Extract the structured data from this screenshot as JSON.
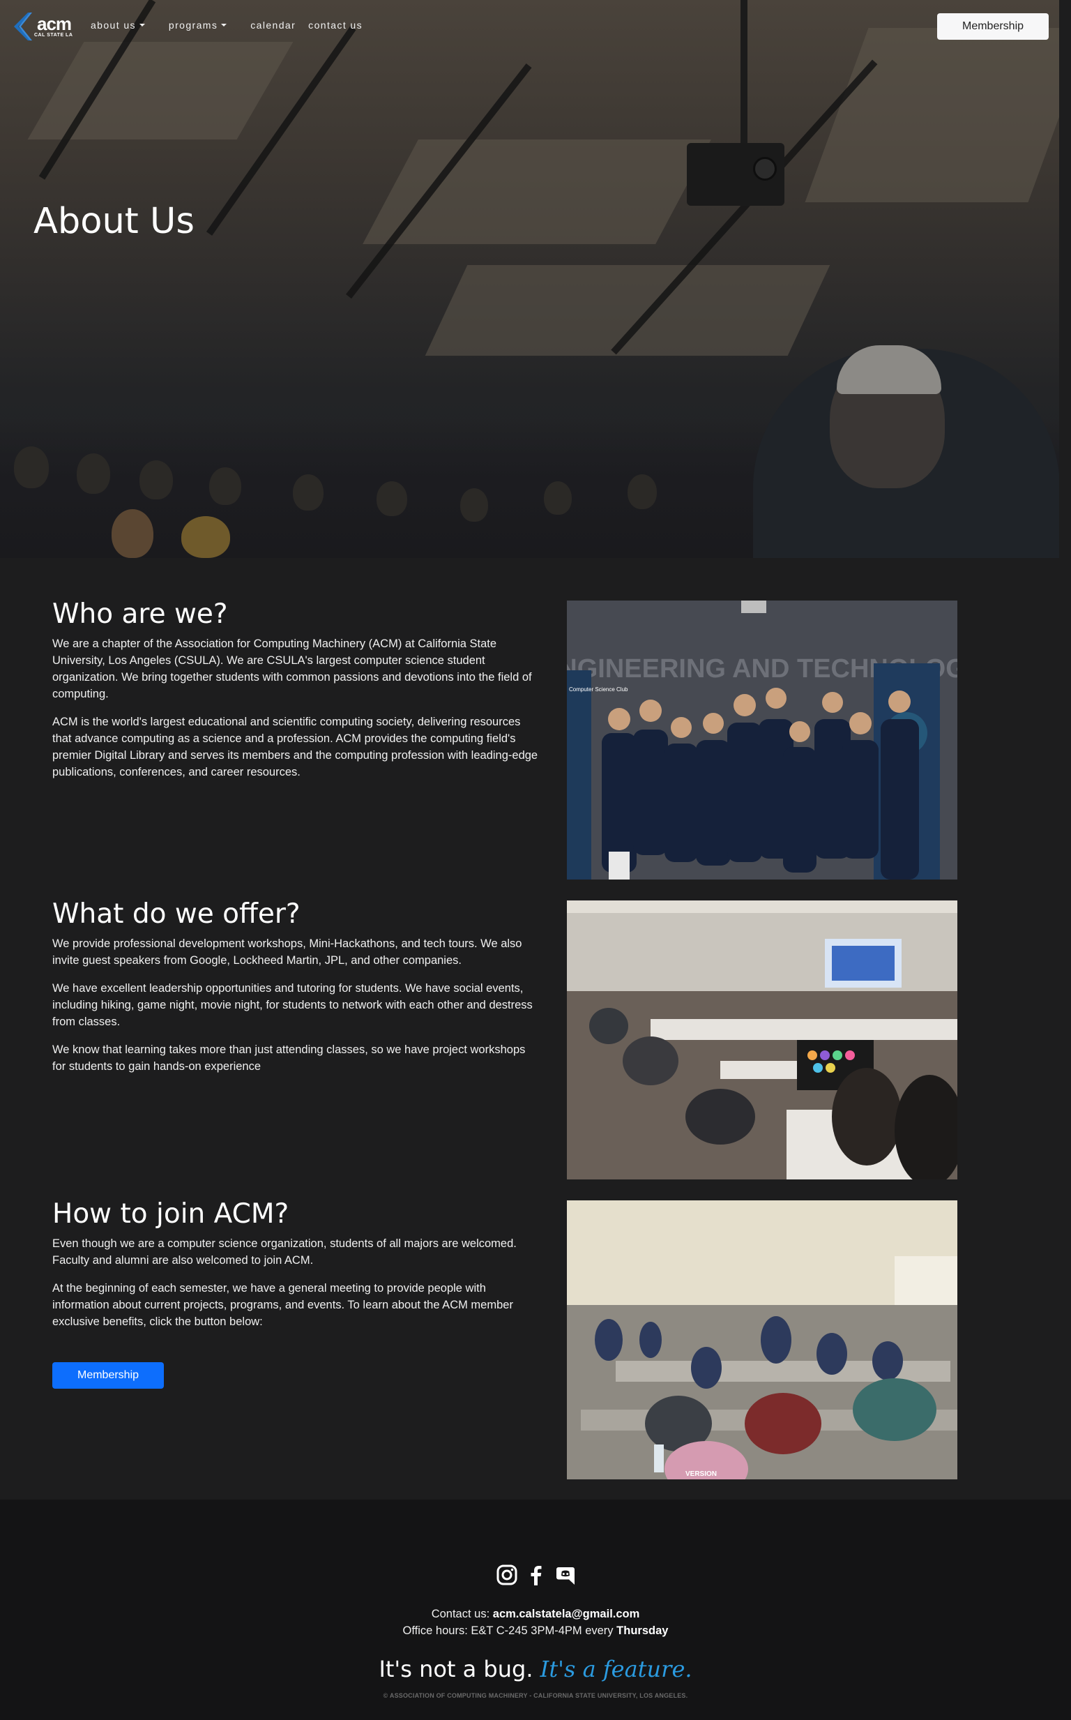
{
  "nav": {
    "logo_text": "acm",
    "logo_sub": "CAL STATE LA",
    "links": [
      {
        "label": "about us",
        "dropdown": true
      },
      {
        "label": "programs",
        "dropdown": true
      },
      {
        "label": "calendar",
        "dropdown": false
      },
      {
        "label": "contact us",
        "dropdown": false
      }
    ],
    "membership_label": "Membership"
  },
  "hero": {
    "title": "About Us"
  },
  "sections": [
    {
      "heading": "Who are we?",
      "paragraphs": [
        "We are a chapter of the Association for Computing Machinery (ACM) at California State University, Los Angeles (CSULA). We are CSULA's largest computer science student organization. We bring together students with common passions and devotions into the field of computing.",
        "ACM is the world's largest educational and scientific computing society, delivering resources that advance computing as a science and a profession. ACM provides the computing field's premier Digital Library and serves its members and the computing profession with leading-edge publications, conferences, and career resources."
      ],
      "photo_text": "ENGINEERING AND TECHNOLOGY",
      "banner_text": "Computer Science Club"
    },
    {
      "heading": "What do we offer?",
      "paragraphs": [
        "We provide professional development workshops, Mini-Hackathons, and tech tours. We also invite guest speakers from Google, Lockheed Martin, JPL, and other companies.",
        "We have excellent leadership opportunities and tutoring for students. We have social events, including hiking, game night, movie night, for students to network with each other and destress from classes.",
        "We know that learning takes more than just attending classes, so we have project workshops for students to gain hands-on experience"
      ]
    },
    {
      "heading": "How to join ACM?",
      "paragraphs": [
        "Even though we are a computer science organization, students of all majors are welcomed. Faculty and alumni are also welcomed to join ACM.",
        "At the beginning of each semester, we have a general meeting to provide people with information about current projects, programs, and events. To learn about the ACM member exclusive benefits, click the button below:"
      ],
      "button_label": "Membership",
      "shirt_text": "VERSION"
    }
  ],
  "footer": {
    "social": [
      "instagram-icon",
      "facebook-icon",
      "discord-icon"
    ],
    "contact_label": "Contact us:",
    "contact_email": "acm.calstatela@gmail.com",
    "office_label": "Office hours: E&T C-245 3PM-4PM every",
    "office_day": "Thursday",
    "tagline_plain": "It's not a bug.",
    "tagline_accent": "It's a feature.",
    "copyright": "© ASSOCIATION OF COMPUTING MACHINERY - CALIFORNIA STATE UNIVERSITY, LOS ANGELES."
  },
  "colors": {
    "page_bg": "#1d1d1e",
    "footer_bg": "#141415",
    "accent_blue": "#0d6efd",
    "tagline_blue": "#2b9be0"
  }
}
